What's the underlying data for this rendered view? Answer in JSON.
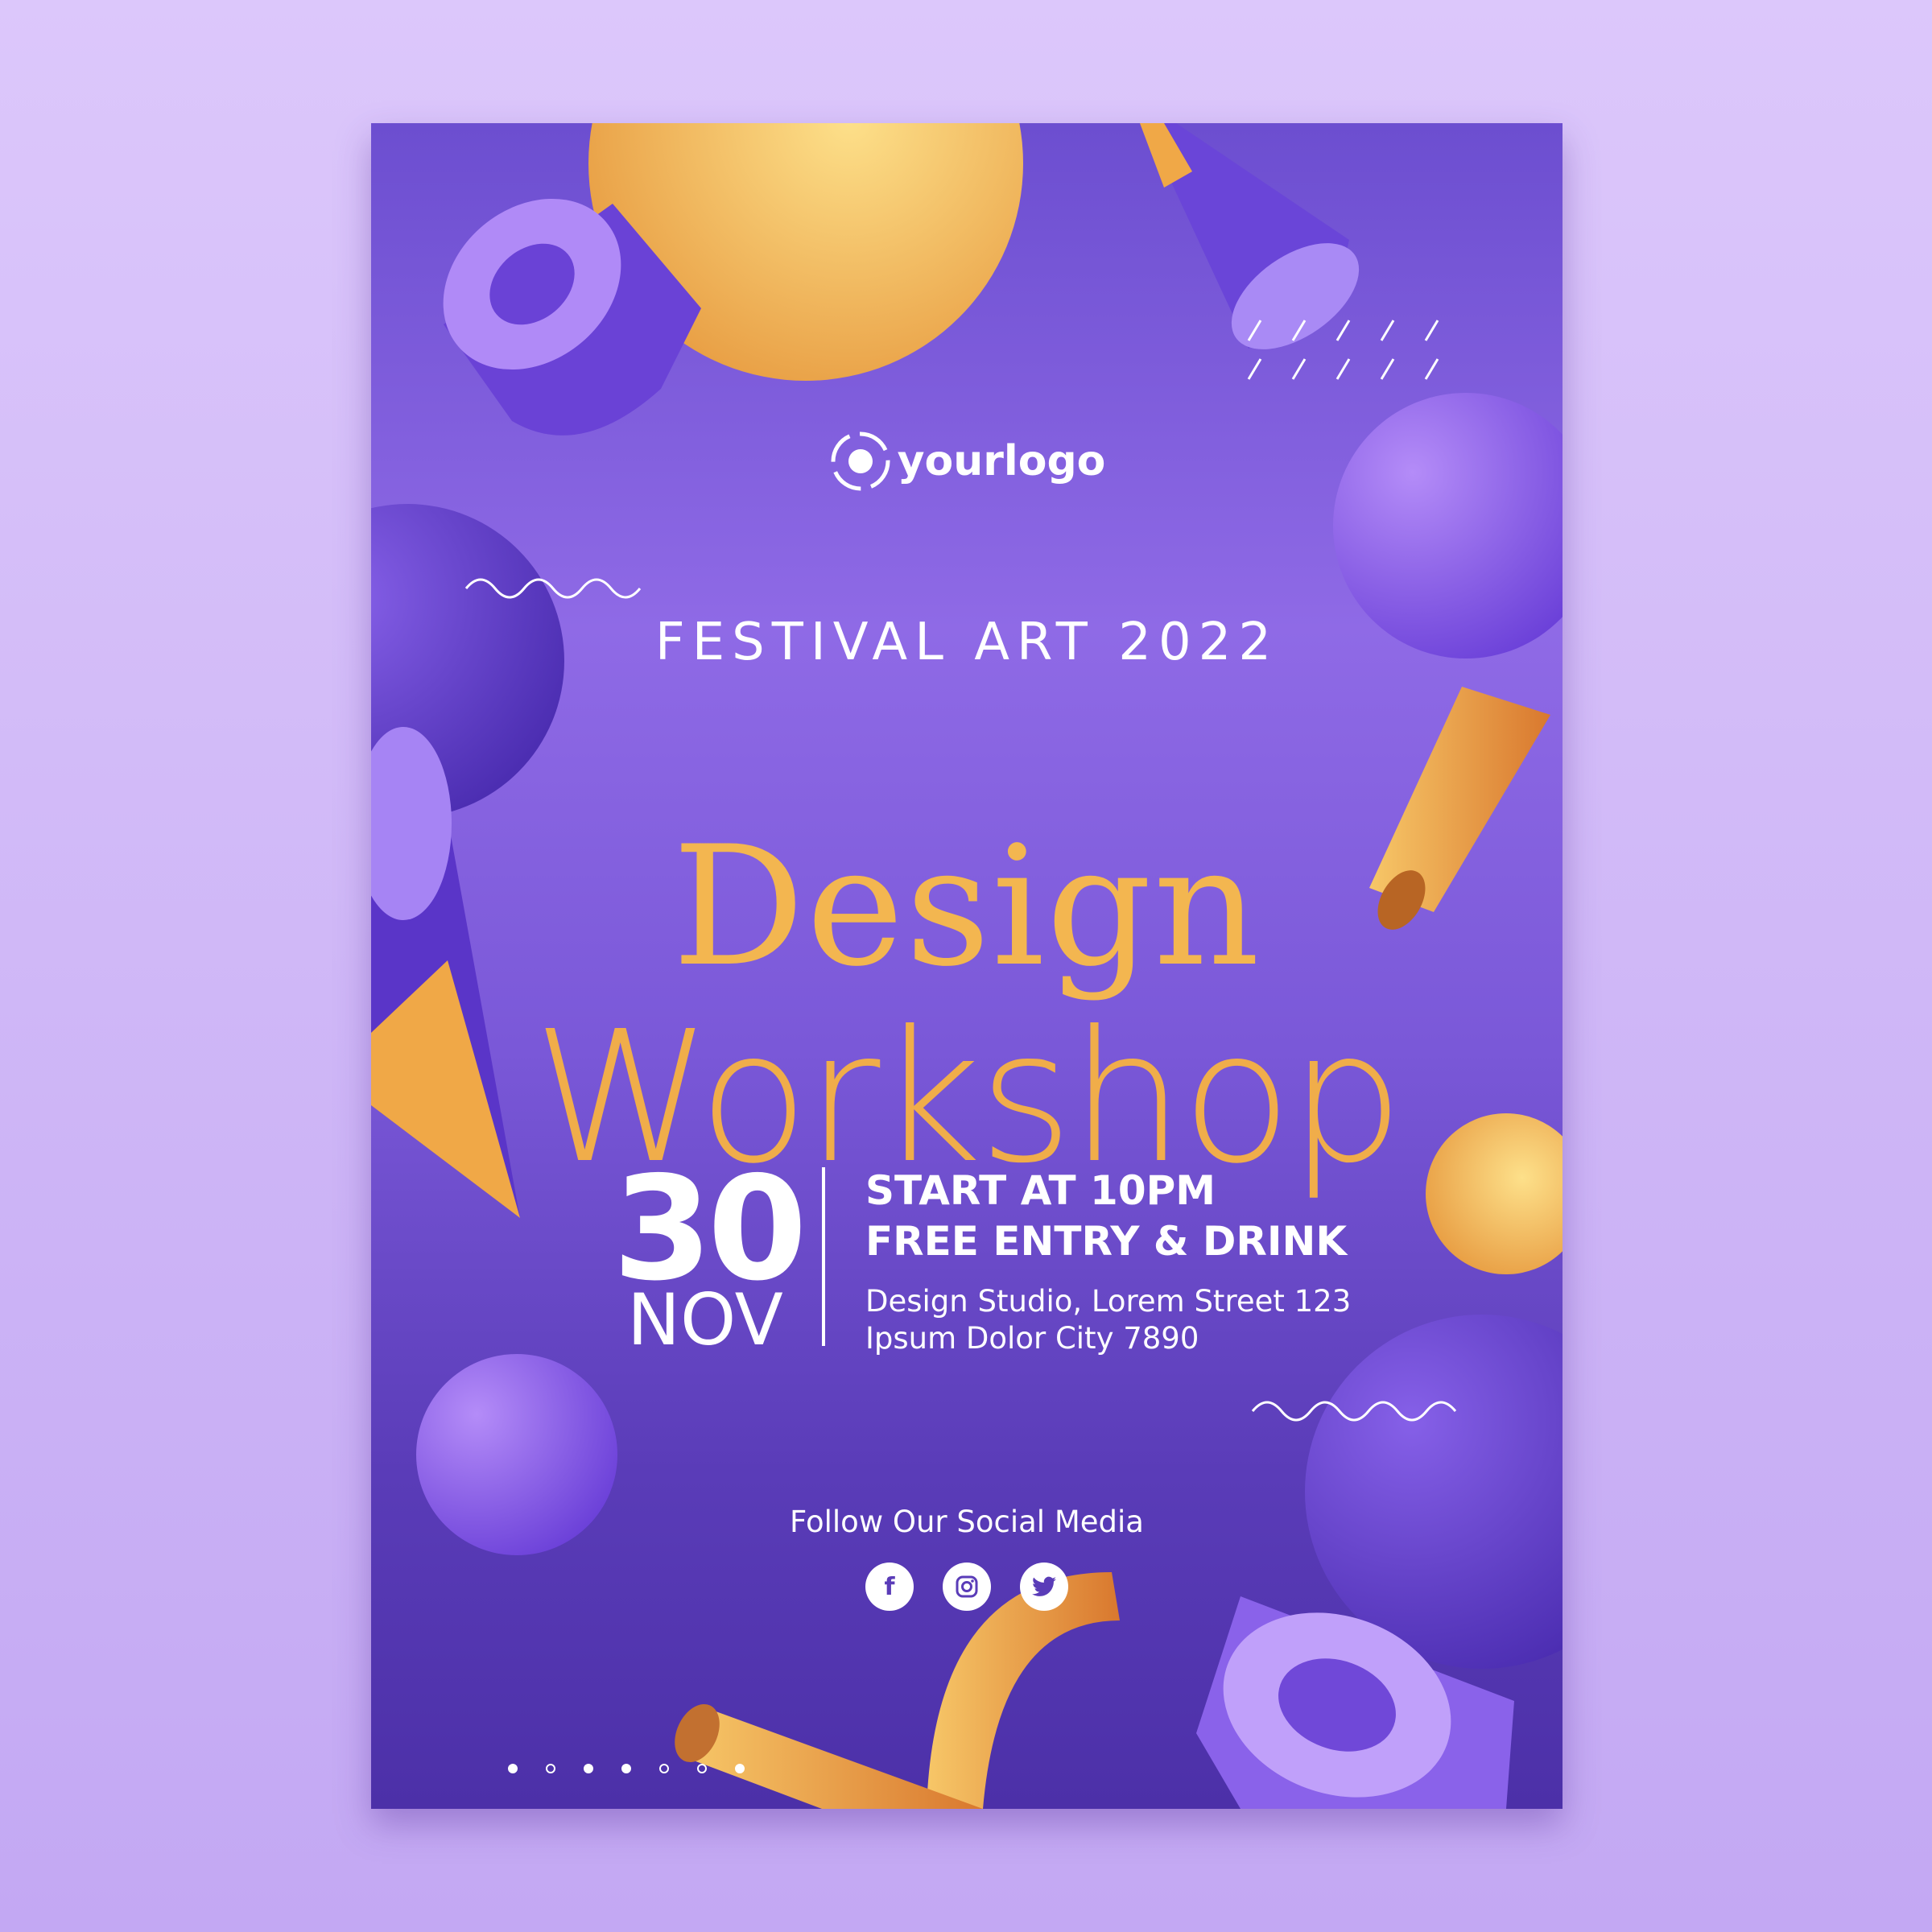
{
  "logo": {
    "text": "yourlogo",
    "icon": "target-icon"
  },
  "event": {
    "subtitle": "FESTIVAL ART 2022",
    "title_line1": "Design",
    "title_line2": "Workshop",
    "day": "30",
    "month": "NOV",
    "time": "START AT 10PM",
    "offer": "FREE ENTRY & DRINK",
    "address_line1": "Design Studio, Lorem Street 123",
    "address_line2": "Ipsum Dolor City 7890"
  },
  "social": {
    "label": "Follow Our Social Media",
    "icons": [
      {
        "name": "facebook-icon",
        "glyph": "f"
      },
      {
        "name": "instagram-icon",
        "glyph": "◎"
      },
      {
        "name": "twitter-icon",
        "glyph": "🐦"
      }
    ]
  },
  "page_dots": [
    true,
    false,
    true,
    true,
    false,
    false,
    true
  ],
  "colors": {
    "background": "#d4bdf8",
    "poster": "#7a58d8",
    "title_orange": "#f2b24e",
    "text": "#ffffff"
  }
}
